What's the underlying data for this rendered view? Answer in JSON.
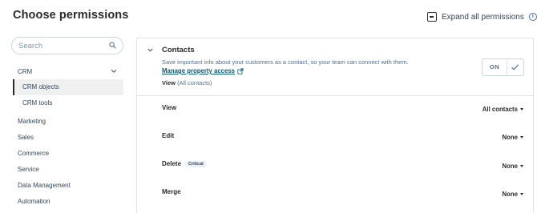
{
  "header": {
    "title": "Choose permissions",
    "expand_all_label": "Expand all permissions",
    "info_glyph": "i"
  },
  "sidebar": {
    "search_placeholder": "Search",
    "crm_label": "CRM",
    "crm_sub": [
      {
        "label": "CRM objects",
        "active": true
      },
      {
        "label": "CRM tools",
        "active": false
      }
    ],
    "items": [
      "Marketing",
      "Sales",
      "Commerce",
      "Service",
      "Data Management",
      "Automation"
    ]
  },
  "contacts": {
    "title": "Contacts",
    "description": "Save important info about your customers as a contact, so your team can connect with them.",
    "manage_link": "Manage property access",
    "view_summary_label": "View",
    "view_summary_value": "(All contacts)",
    "toggle_label": "ON",
    "toggle_on": true
  },
  "permissions": [
    {
      "name": "View",
      "value": "All contacts",
      "badge": ""
    },
    {
      "name": "Edit",
      "value": "None",
      "badge": ""
    },
    {
      "name": "Delete",
      "value": "None",
      "badge": "Critical"
    },
    {
      "name": "Merge",
      "value": "None",
      "badge": ""
    }
  ],
  "icons": {
    "expand": "collapse-square-icon",
    "info": "info-icon",
    "search": "search-icon",
    "chevron": "chevron-down-icon",
    "caret": "caret-down-icon",
    "external": "external-link-icon",
    "check": "check-icon"
  },
  "colors": {
    "text": "#33475b",
    "heading": "#2b2b2b",
    "link": "#0b5b74",
    "border": "#dfe3eb",
    "active_bg": "#f0f0f0"
  }
}
